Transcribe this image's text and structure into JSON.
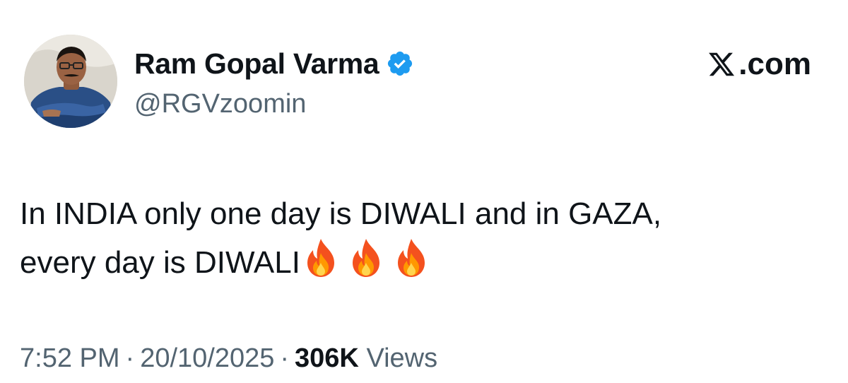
{
  "tweet": {
    "author": {
      "display_name": "Ram Gopal Varma",
      "handle": "@RGVzoomin",
      "verified": true,
      "verified_color": "#1d9bf0"
    },
    "brand": {
      "icon": "x-logo-icon",
      "text": ".com"
    },
    "text": {
      "line1": "In INDIA only one day is DIWALI and in GAZA,",
      "line2": "every day is DIWALI",
      "emojis": [
        "fire-icon",
        "fire-icon",
        "fire-icon"
      ]
    },
    "meta": {
      "time": "7:52 PM",
      "separator": "·",
      "date": "20/10/2025",
      "views_count": "306K",
      "views_label": "Views"
    }
  }
}
